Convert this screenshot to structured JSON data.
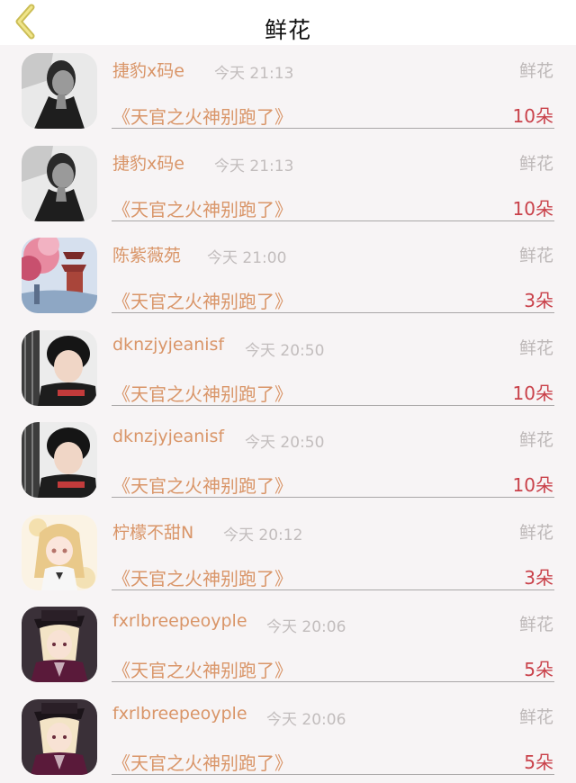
{
  "header": {
    "title": "鲜花",
    "back_icon": "chevron-left-icon",
    "accent": "#d9c760"
  },
  "colors": {
    "name": "#d99568",
    "count": "#c9414a",
    "muted": "#c2bdbd"
  },
  "items": [
    {
      "name": "捷豹x码e",
      "time": "今天 21:13",
      "type": "鲜花",
      "book": "《天官之火神别跑了》",
      "count": "10朵",
      "avatar": "bw-man"
    },
    {
      "name": "捷豹x码e",
      "time": "今天 21:13",
      "type": "鲜花",
      "book": "《天官之火神别跑了》",
      "count": "10朵",
      "avatar": "bw-man"
    },
    {
      "name": "陈紫薇苑",
      "time": "今天 21:00",
      "type": "鲜花",
      "book": "《天官之火神别跑了》",
      "count": "3朵",
      "avatar": "pagoda"
    },
    {
      "name": "dknzjyjeanisf",
      "time": "今天 20:50",
      "type": "鲜花",
      "book": "《天官之火神别跑了》",
      "count": "10朵",
      "avatar": "boy"
    },
    {
      "name": "dknzjyjeanisf",
      "time": "今天 20:50",
      "type": "鲜花",
      "book": "《天官之火神别跑了》",
      "count": "10朵",
      "avatar": "boy"
    },
    {
      "name": "柠檬不甜N",
      "time": "今天 20:12",
      "type": "鲜花",
      "book": "《天官之火神别跑了》",
      "count": "3朵",
      "avatar": "anime-girl"
    },
    {
      "name": "fxrlbreepeoyple",
      "time": "今天 20:06",
      "type": "鲜花",
      "book": "《天官之火神别跑了》",
      "count": "5朵",
      "avatar": "anime-hat"
    },
    {
      "name": "fxrlbreepeoyple",
      "time": "今天 20:06",
      "type": "鲜花",
      "book": "《天官之火神别跑了》",
      "count": "5朵",
      "avatar": "anime-hat"
    }
  ]
}
